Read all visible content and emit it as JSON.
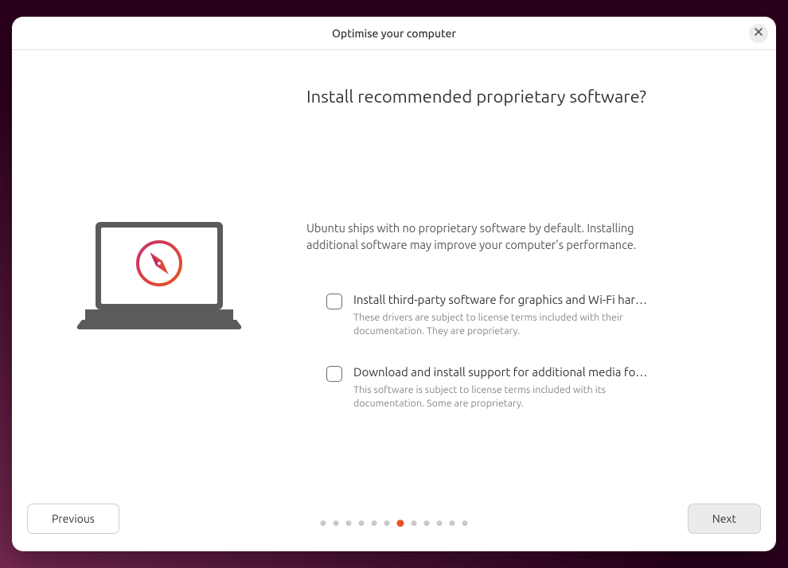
{
  "titlebar": {
    "title": "Optimise your computer"
  },
  "page": {
    "heading": "Install recommended proprietary software?",
    "description": "Ubuntu ships with no proprietary software by default. Installing additional software may improve your computer's performance."
  },
  "options": [
    {
      "title": "Install third-party software for graphics and Wi-Fi hardware",
      "subtitle": "These drivers are subject to license terms included with their documentation. They are proprietary.",
      "checked": false
    },
    {
      "title": "Download and install support for additional media formats",
      "subtitle": "This software is subject to license terms included with its documentation. Some are proprietary.",
      "checked": false
    }
  ],
  "footer": {
    "previous_label": "Previous",
    "next_label": "Next"
  },
  "progress": {
    "total_steps": 12,
    "current_step": 7
  },
  "icons": {
    "close": "close-icon",
    "compass": "compass-icon"
  },
  "colors": {
    "accent": "#e95420",
    "accent_gradient_end": "#c6316f"
  }
}
